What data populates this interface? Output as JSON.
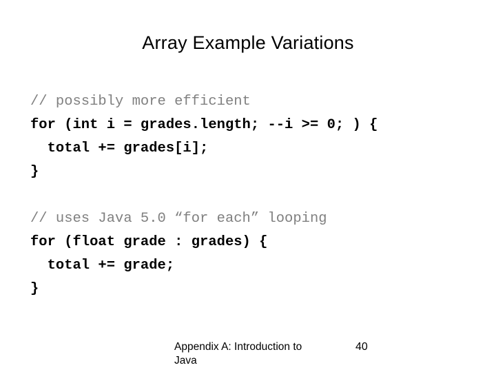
{
  "slide": {
    "title": "Array Example Variations",
    "code_lines": [
      {
        "text": "// possibly more efficient",
        "style": "comment"
      },
      {
        "text": "for (int i = grades.length; --i >= 0; ) {",
        "style": "code"
      },
      {
        "text": "  total += grades[i];",
        "style": "code"
      },
      {
        "text": "}",
        "style": "code"
      },
      {
        "text": " ",
        "style": "blank"
      },
      {
        "text": "// uses Java 5.0 “for each” looping",
        "style": "comment"
      },
      {
        "text": "for (float grade : grades) {",
        "style": "code"
      },
      {
        "text": "  total += grade;",
        "style": "code"
      },
      {
        "text": "}",
        "style": "code"
      }
    ],
    "footer_text": "Appendix A: Introduction to Java",
    "page_number": "40",
    "colors": {
      "background": "#ffffff",
      "text": "#000000",
      "comment": "#808080"
    }
  }
}
